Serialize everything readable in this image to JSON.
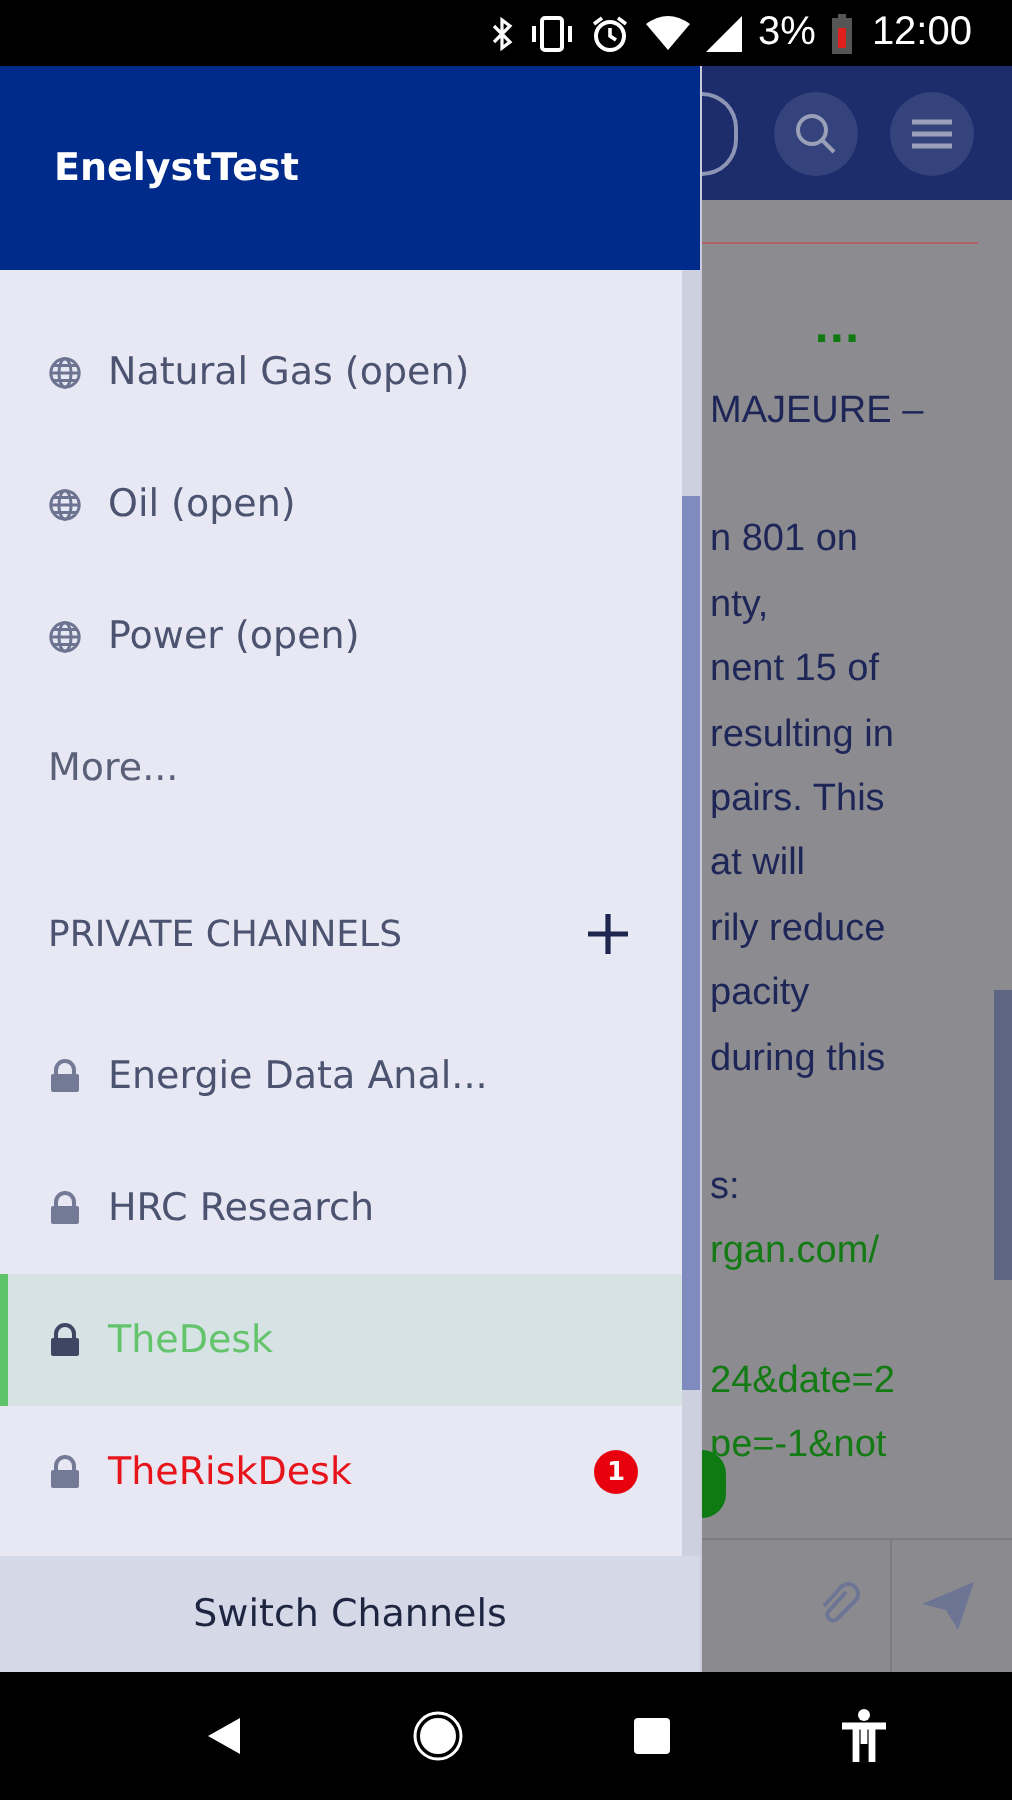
{
  "status_bar": {
    "battery": "3%",
    "time": "12:00"
  },
  "drawer": {
    "title": "EnelystTest",
    "public_channels": [
      {
        "name": "Natural Gas (open)"
      },
      {
        "name": "Oil (open)"
      },
      {
        "name": "Power (open)"
      }
    ],
    "more_link": "More...",
    "private_header": "PRIVATE CHANNELS",
    "private_channels": [
      {
        "name": "Energie Data Anal...",
        "selected": false,
        "unread": false
      },
      {
        "name": "HRC Research",
        "selected": false,
        "unread": false
      },
      {
        "name": "TheDesk",
        "selected": true,
        "unread": false
      },
      {
        "name": "TheRiskDesk",
        "selected": false,
        "unread": true,
        "badge": "1"
      }
    ],
    "switch_button": "Switch Channels"
  },
  "background_message": {
    "ellipsis": "...",
    "lines": [
      {
        "text": "MAJEURE –",
        "kind": "text"
      },
      {
        "text": "n 801 on",
        "kind": "text"
      },
      {
        "text": "nty,",
        "kind": "text"
      },
      {
        "text": "nent 15 of",
        "kind": "text"
      },
      {
        "text": "resulting in",
        "kind": "text"
      },
      {
        "text": "pairs.  This",
        "kind": "text"
      },
      {
        "text": "at will",
        "kind": "text"
      },
      {
        "text": "rily reduce",
        "kind": "text"
      },
      {
        "text": "pacity",
        "kind": "text"
      },
      {
        "text": "during this",
        "kind": "text"
      },
      {
        "text": "s:",
        "kind": "text"
      },
      {
        "text": "rgan.com/",
        "kind": "link"
      },
      {
        "text": "24&date=2",
        "kind": "link"
      },
      {
        "text": "pe=-1&not",
        "kind": "link"
      }
    ]
  }
}
